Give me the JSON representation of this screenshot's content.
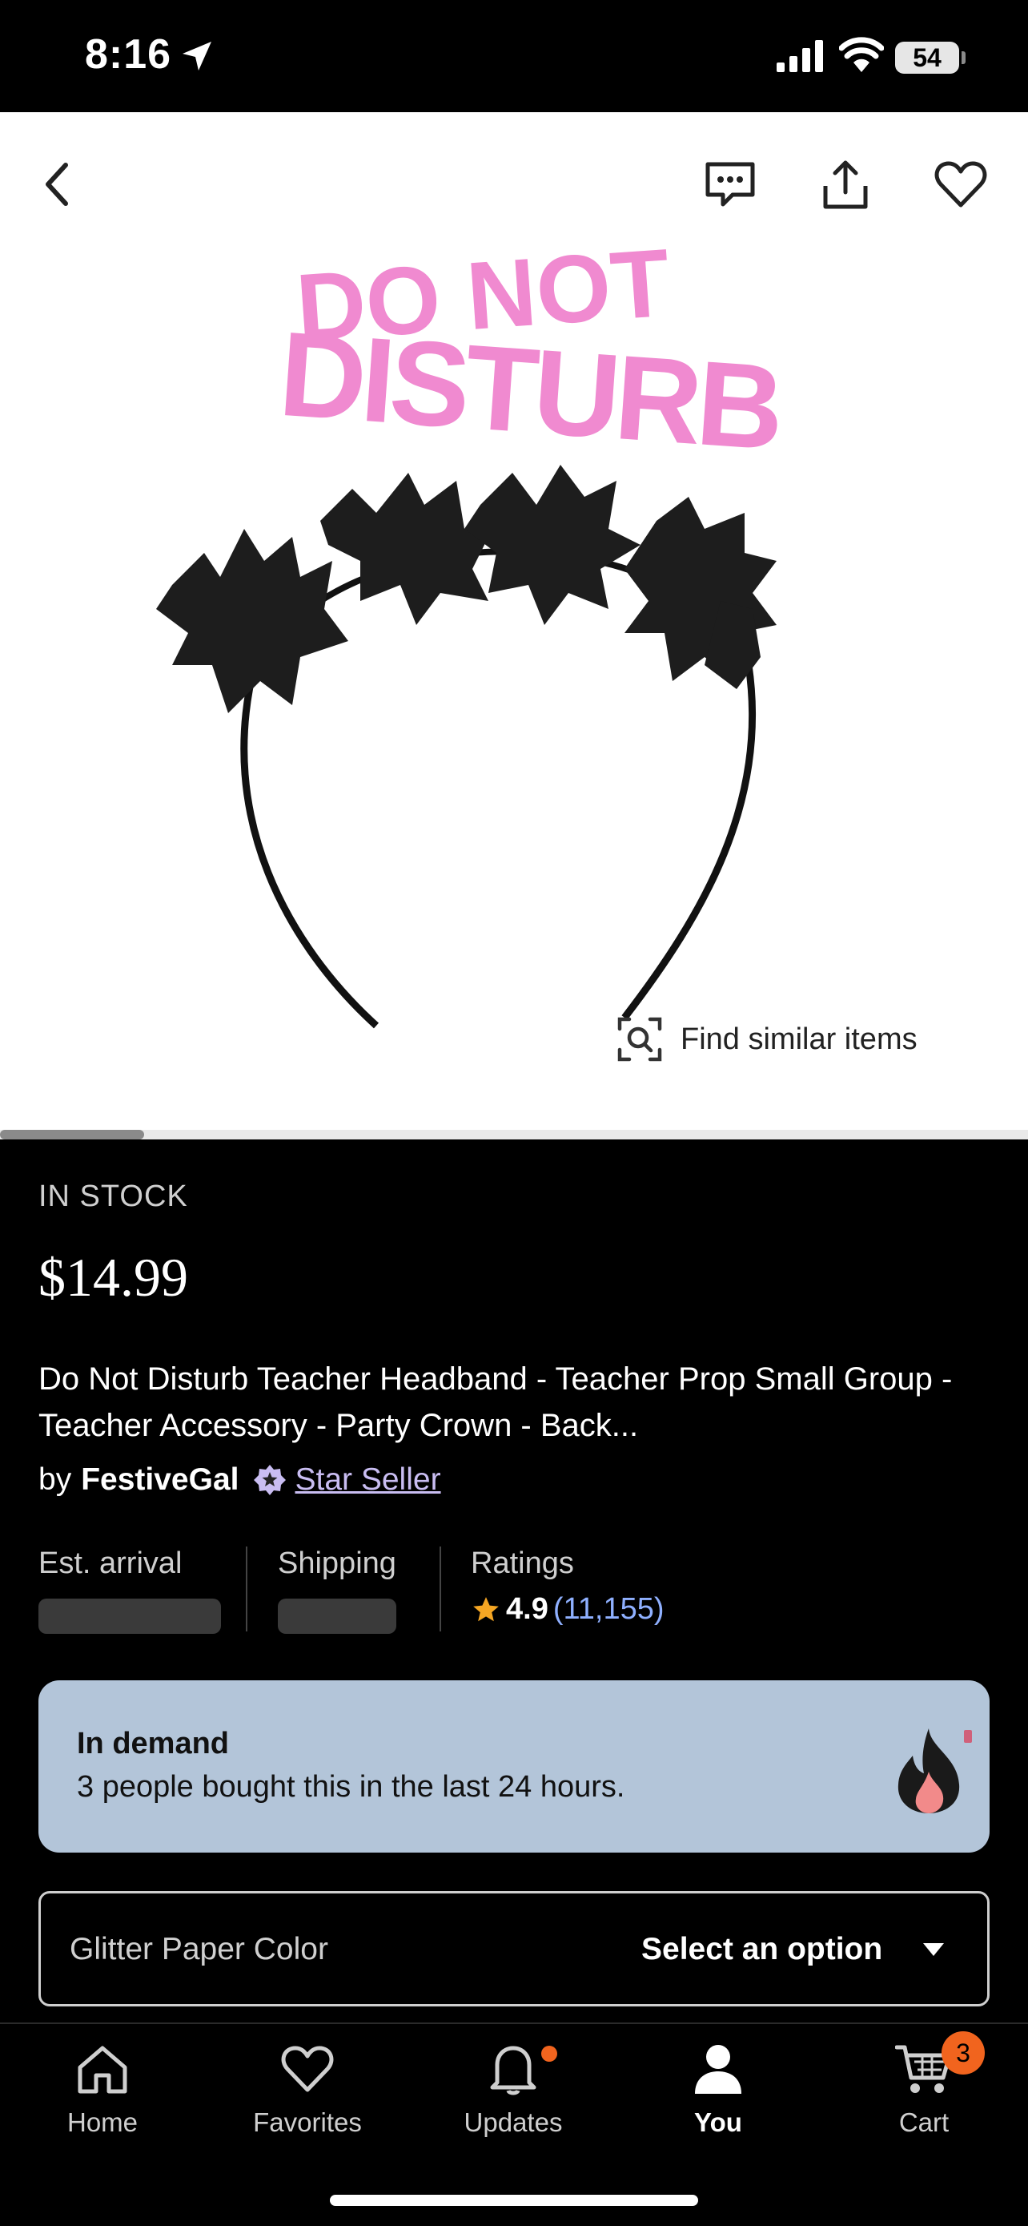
{
  "status_bar": {
    "time": "8:16",
    "battery": "54"
  },
  "image": {
    "alt_headline": "DO NOT DISTURB",
    "find_similar_label": "Find similar items",
    "carousel_position": 0.14
  },
  "product": {
    "stock_status": "IN STOCK",
    "price": "$14.99",
    "title": "Do Not Disturb Teacher Headband - Teacher Prop Small Group - Teacher Accessory - Party Crown - Back...",
    "by_label": "by",
    "shop_name": "FestiveGal",
    "badge_label": "Star Seller"
  },
  "meta": {
    "arrival_label": "Est. arrival",
    "shipping_label": "Shipping",
    "ratings_label": "Ratings",
    "rating_value": "4.9",
    "rating_count": "(11,155)"
  },
  "demand": {
    "heading": "In demand",
    "text": "3 people bought this in the last 24 hours."
  },
  "variation": {
    "label": "Glitter Paper Color",
    "value": "Select an option"
  },
  "nav": {
    "home": "Home",
    "favorites": "Favorites",
    "updates": "Updates",
    "you": "You",
    "cart": "Cart",
    "cart_count": "3"
  },
  "colors": {
    "accent_orange": "#f1641e",
    "demand_bg": "#b3c5d9",
    "link_purple": "#c9bdf2",
    "rating_blue": "#8fb0ff",
    "star_gold": "#f5a623"
  },
  "icons": [
    "back-icon",
    "chat-icon",
    "share-icon",
    "heart-icon",
    "visual-search-icon",
    "star-seller-badge-icon",
    "star-icon",
    "fire-icon",
    "caret-down-icon",
    "home-icon",
    "favorites-icon",
    "bell-icon",
    "user-icon",
    "cart-icon"
  ]
}
